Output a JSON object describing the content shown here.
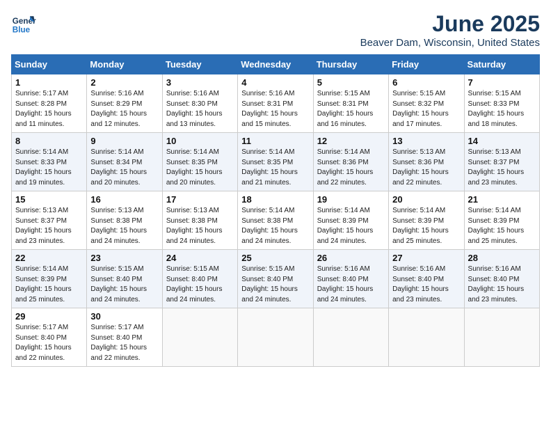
{
  "header": {
    "logo_line1": "General",
    "logo_line2": "Blue",
    "title": "June 2025",
    "subtitle": "Beaver Dam, Wisconsin, United States"
  },
  "weekdays": [
    "Sunday",
    "Monday",
    "Tuesday",
    "Wednesday",
    "Thursday",
    "Friday",
    "Saturday"
  ],
  "weeks": [
    [
      {
        "day": "1",
        "sunrise": "5:17 AM",
        "sunset": "8:28 PM",
        "daylight": "15 hours and 11 minutes."
      },
      {
        "day": "2",
        "sunrise": "5:16 AM",
        "sunset": "8:29 PM",
        "daylight": "15 hours and 12 minutes."
      },
      {
        "day": "3",
        "sunrise": "5:16 AM",
        "sunset": "8:30 PM",
        "daylight": "15 hours and 13 minutes."
      },
      {
        "day": "4",
        "sunrise": "5:16 AM",
        "sunset": "8:31 PM",
        "daylight": "15 hours and 15 minutes."
      },
      {
        "day": "5",
        "sunrise": "5:15 AM",
        "sunset": "8:31 PM",
        "daylight": "15 hours and 16 minutes."
      },
      {
        "day": "6",
        "sunrise": "5:15 AM",
        "sunset": "8:32 PM",
        "daylight": "15 hours and 17 minutes."
      },
      {
        "day": "7",
        "sunrise": "5:15 AM",
        "sunset": "8:33 PM",
        "daylight": "15 hours and 18 minutes."
      }
    ],
    [
      {
        "day": "8",
        "sunrise": "5:14 AM",
        "sunset": "8:33 PM",
        "daylight": "15 hours and 19 minutes."
      },
      {
        "day": "9",
        "sunrise": "5:14 AM",
        "sunset": "8:34 PM",
        "daylight": "15 hours and 20 minutes."
      },
      {
        "day": "10",
        "sunrise": "5:14 AM",
        "sunset": "8:35 PM",
        "daylight": "15 hours and 20 minutes."
      },
      {
        "day": "11",
        "sunrise": "5:14 AM",
        "sunset": "8:35 PM",
        "daylight": "15 hours and 21 minutes."
      },
      {
        "day": "12",
        "sunrise": "5:14 AM",
        "sunset": "8:36 PM",
        "daylight": "15 hours and 22 minutes."
      },
      {
        "day": "13",
        "sunrise": "5:13 AM",
        "sunset": "8:36 PM",
        "daylight": "15 hours and 22 minutes."
      },
      {
        "day": "14",
        "sunrise": "5:13 AM",
        "sunset": "8:37 PM",
        "daylight": "15 hours and 23 minutes."
      }
    ],
    [
      {
        "day": "15",
        "sunrise": "5:13 AM",
        "sunset": "8:37 PM",
        "daylight": "15 hours and 23 minutes."
      },
      {
        "day": "16",
        "sunrise": "5:13 AM",
        "sunset": "8:38 PM",
        "daylight": "15 hours and 24 minutes."
      },
      {
        "day": "17",
        "sunrise": "5:13 AM",
        "sunset": "8:38 PM",
        "daylight": "15 hours and 24 minutes."
      },
      {
        "day": "18",
        "sunrise": "5:14 AM",
        "sunset": "8:38 PM",
        "daylight": "15 hours and 24 minutes."
      },
      {
        "day": "19",
        "sunrise": "5:14 AM",
        "sunset": "8:39 PM",
        "daylight": "15 hours and 24 minutes."
      },
      {
        "day": "20",
        "sunrise": "5:14 AM",
        "sunset": "8:39 PM",
        "daylight": "15 hours and 25 minutes."
      },
      {
        "day": "21",
        "sunrise": "5:14 AM",
        "sunset": "8:39 PM",
        "daylight": "15 hours and 25 minutes."
      }
    ],
    [
      {
        "day": "22",
        "sunrise": "5:14 AM",
        "sunset": "8:39 PM",
        "daylight": "15 hours and 25 minutes."
      },
      {
        "day": "23",
        "sunrise": "5:15 AM",
        "sunset": "8:40 PM",
        "daylight": "15 hours and 24 minutes."
      },
      {
        "day": "24",
        "sunrise": "5:15 AM",
        "sunset": "8:40 PM",
        "daylight": "15 hours and 24 minutes."
      },
      {
        "day": "25",
        "sunrise": "5:15 AM",
        "sunset": "8:40 PM",
        "daylight": "15 hours and 24 minutes."
      },
      {
        "day": "26",
        "sunrise": "5:16 AM",
        "sunset": "8:40 PM",
        "daylight": "15 hours and 24 minutes."
      },
      {
        "day": "27",
        "sunrise": "5:16 AM",
        "sunset": "8:40 PM",
        "daylight": "15 hours and 23 minutes."
      },
      {
        "day": "28",
        "sunrise": "5:16 AM",
        "sunset": "8:40 PM",
        "daylight": "15 hours and 23 minutes."
      }
    ],
    [
      {
        "day": "29",
        "sunrise": "5:17 AM",
        "sunset": "8:40 PM",
        "daylight": "15 hours and 22 minutes."
      },
      {
        "day": "30",
        "sunrise": "5:17 AM",
        "sunset": "8:40 PM",
        "daylight": "15 hours and 22 minutes."
      },
      null,
      null,
      null,
      null,
      null
    ]
  ]
}
